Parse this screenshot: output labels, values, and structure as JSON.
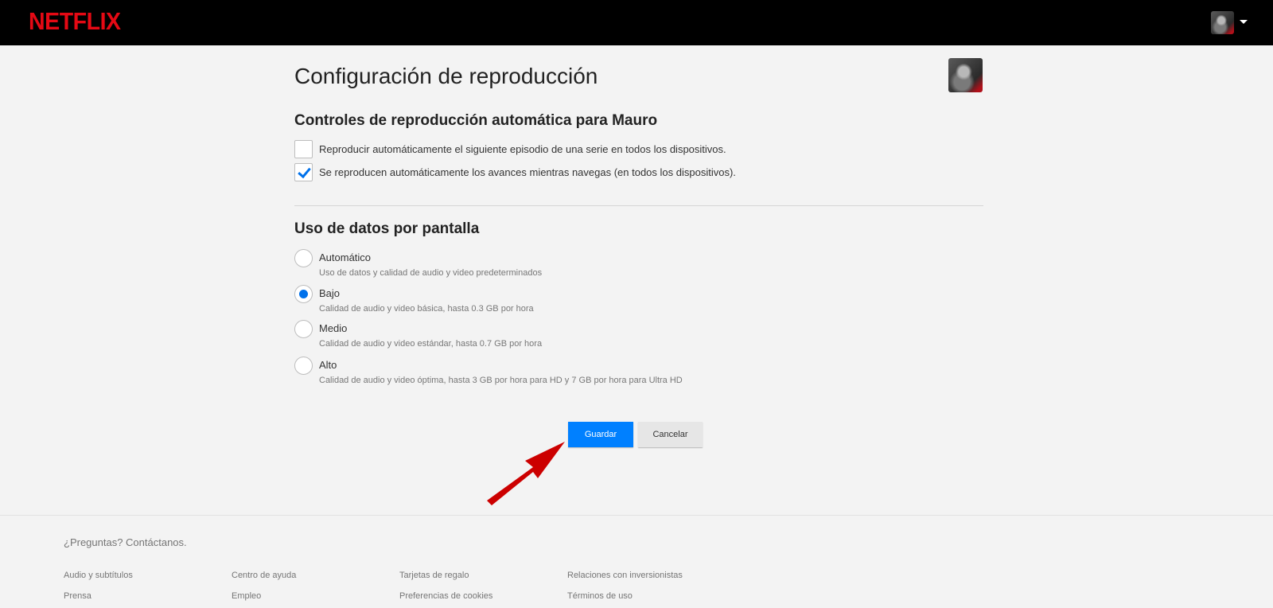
{
  "header": {
    "logo_text": "NETFLIX",
    "brand_color": "#e50914",
    "profile_icon": "profile-avatar",
    "dropdown_icon": "caret-down-icon"
  },
  "main": {
    "title": "Configuración de reproducción",
    "autoplay_section": {
      "title": "Controles de reproducción automática para Mauro",
      "options": [
        {
          "label": "Reproducir automáticamente el siguiente episodio de una serie en todos los dispositivos.",
          "checked": false
        },
        {
          "label": "Se reproducen automáticamente los avances mientras navegas (en todos los dispositivos).",
          "checked": true
        }
      ]
    },
    "data_section": {
      "title": "Uso de datos por pantalla",
      "options": [
        {
          "label": "Automático",
          "description": "Uso de datos y calidad de audio y video predeterminados",
          "selected": false
        },
        {
          "label": "Bajo",
          "description": "Calidad de audio y video básica, hasta 0.3 GB por hora",
          "selected": true
        },
        {
          "label": "Medio",
          "description": "Calidad de audio y video estándar, hasta 0.7 GB por hora",
          "selected": false
        },
        {
          "label": "Alto",
          "description": "Calidad de audio y video óptima, hasta 3 GB por hora para HD y 7 GB por hora para Ultra HD",
          "selected": false
        }
      ]
    },
    "buttons": {
      "save": "Guardar",
      "cancel": "Cancelar"
    },
    "accent_color": "#0080ff",
    "annotation_arrow_color": "#cc0000"
  },
  "footer": {
    "question": "¿Preguntas? Contáctanos.",
    "links": [
      "Audio y subtítulos",
      "Centro de ayuda",
      "Tarjetas de regalo",
      "Relaciones con inversionistas",
      "Prensa",
      "Empleo",
      "Preferencias de cookies",
      "Términos de uso"
    ]
  }
}
